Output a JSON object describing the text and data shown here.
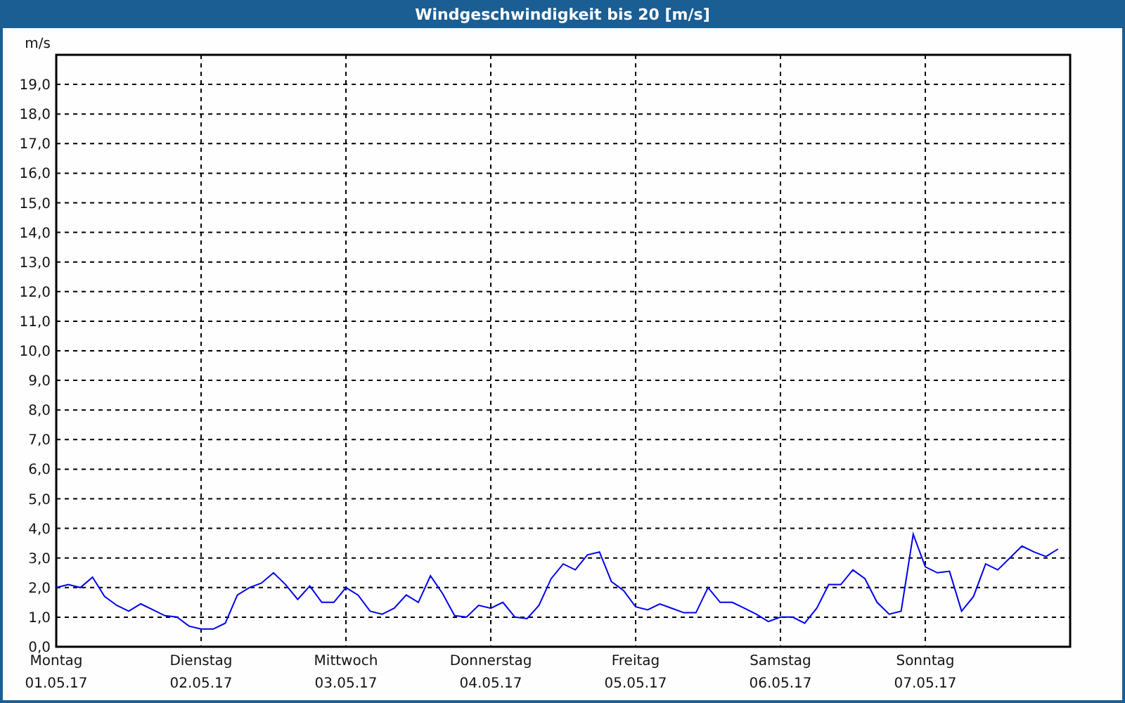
{
  "window": {
    "title": "Windgeschwindigkeit bis 20 [m/s]"
  },
  "chart": {
    "x_sublabels": [
      "01.05.17",
      "02.05.17",
      "03.05.17",
      "04.05.17",
      "05.05.17",
      "06.05.17",
      "07.05.17"
    ],
    "chart_data": {
      "type": "line",
      "ylabel": "m/s",
      "ylim": [
        0,
        20
      ],
      "grid": true,
      "categories": [
        "Montag",
        null,
        null,
        null,
        null,
        null,
        null,
        null,
        null,
        null,
        null,
        null,
        "Dienstag",
        null,
        null,
        null,
        null,
        null,
        null,
        null,
        null,
        null,
        null,
        null,
        "Mittwoch",
        null,
        null,
        null,
        null,
        null,
        null,
        null,
        null,
        null,
        null,
        null,
        "Donnerstag",
        null,
        null,
        null,
        null,
        null,
        null,
        null,
        null,
        null,
        null,
        null,
        "Freitag",
        null,
        null,
        null,
        null,
        null,
        null,
        null,
        null,
        null,
        null,
        null,
        "Samstag",
        null,
        null,
        null,
        null,
        null,
        null,
        null,
        null,
        null,
        null,
        null,
        "Sonntag",
        null,
        null,
        null,
        null,
        null,
        null,
        null,
        null,
        null,
        null,
        null
      ],
      "yticks": [
        {
          "value": 0,
          "label": "0,0"
        },
        {
          "value": 1,
          "label": "1,0"
        },
        {
          "value": 2,
          "label": "2,0"
        },
        {
          "value": 3,
          "label": "3,0"
        },
        {
          "value": 4,
          "label": "4,0"
        },
        {
          "value": 5,
          "label": "5,0"
        },
        {
          "value": 6,
          "label": "6,0"
        },
        {
          "value": 7,
          "label": "7,0"
        },
        {
          "value": 8,
          "label": "8,0"
        },
        {
          "value": 9,
          "label": "9,0"
        },
        {
          "value": 10,
          "label": "10,0"
        },
        {
          "value": 11,
          "label": "11,0"
        },
        {
          "value": 12,
          "label": "12,0"
        },
        {
          "value": 13,
          "label": "13,0"
        },
        {
          "value": 14,
          "label": "14,0"
        },
        {
          "value": 15,
          "label": "15,0"
        },
        {
          "value": 16,
          "label": "16,0"
        },
        {
          "value": 17,
          "label": "17,0"
        },
        {
          "value": 18,
          "label": "18,0"
        },
        {
          "value": 19,
          "label": "19,0"
        }
      ],
      "series": [
        {
          "color": "#0000ee",
          "values": [
            2.0,
            2.1,
            2.0,
            2.35,
            1.7,
            1.4,
            1.2,
            1.45,
            1.25,
            1.05,
            1.0,
            0.7,
            0.6,
            0.6,
            0.8,
            1.75,
            2.0,
            2.15,
            2.5,
            2.1,
            1.6,
            2.05,
            1.5,
            1.5,
            2.0,
            1.75,
            1.2,
            1.1,
            1.3,
            1.75,
            1.5,
            2.4,
            1.8,
            1.05,
            1.0,
            1.4,
            1.3,
            1.5,
            1.0,
            0.95,
            1.4,
            2.3,
            2.8,
            2.6,
            3.1,
            3.2,
            2.2,
            1.9,
            1.35,
            1.25,
            1.45,
            1.3,
            1.15,
            1.15,
            2.0,
            1.5,
            1.5,
            1.3,
            1.1,
            0.85,
            1.0,
            1.0,
            0.8,
            1.3,
            2.1,
            2.1,
            2.6,
            2.3,
            1.5,
            1.1,
            1.2,
            3.8,
            2.7,
            2.5,
            2.55,
            1.2,
            1.7,
            2.8,
            2.6,
            3.0,
            3.4,
            3.2,
            3.05,
            3.3
          ]
        }
      ]
    }
  }
}
